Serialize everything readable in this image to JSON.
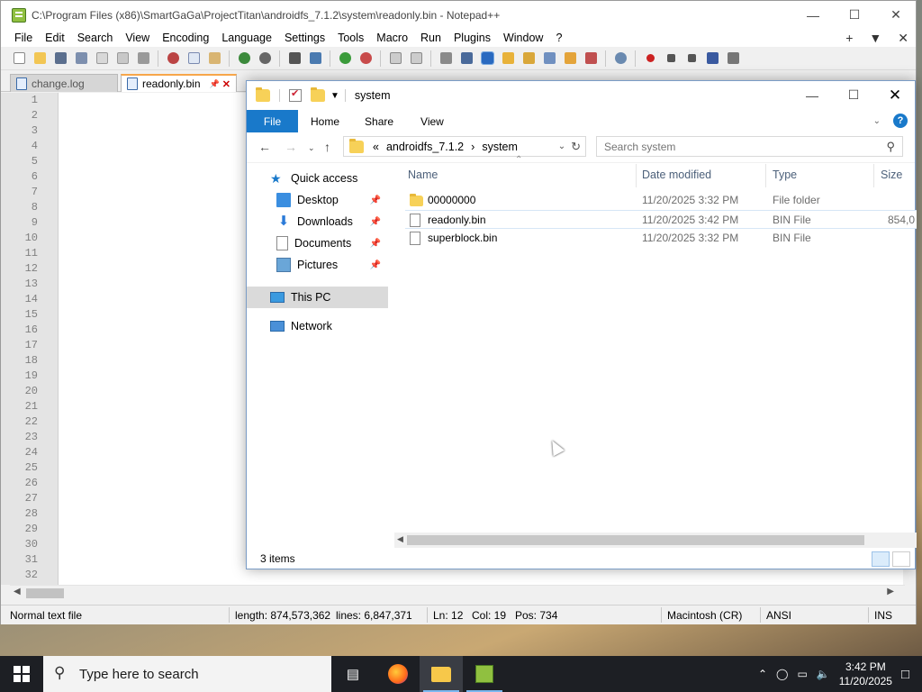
{
  "npp": {
    "title": "C:\\Program Files (x86)\\SmartGaGa\\ProjectTitan\\androidfs_7.1.2\\system\\readonly.bin - Notepad++",
    "menu": [
      "File",
      "Edit",
      "Search",
      "View",
      "Encoding",
      "Language",
      "Settings",
      "Tools",
      "Macro",
      "Run",
      "Plugins",
      "Window",
      "?"
    ],
    "menu_right": [
      "+",
      "▼",
      "✕"
    ],
    "tabs": [
      {
        "label": "change.log"
      },
      {
        "label": "readonly.bin",
        "pin": "📌",
        "close": "✕"
      }
    ],
    "gutter": [
      "1",
      "2",
      "3",
      "4",
      "5",
      "6",
      "7",
      "8",
      "9",
      "10",
      "11",
      "12",
      "13",
      "14",
      "15",
      "16",
      "17",
      "18",
      "19",
      "20",
      "21",
      "22",
      "23",
      "24",
      "25",
      "26",
      "27",
      "28",
      "29",
      "30",
      "31",
      "32"
    ],
    "status": {
      "type": "Normal text file",
      "length": "length: 874,573,362",
      "lines": "lines: 6,847,371",
      "ln": "Ln: 12",
      "col": "Col: 19",
      "pos": "Pos: 734",
      "eol": "Macintosh (CR)",
      "encoding": "ANSI",
      "mode": "INS"
    }
  },
  "explorer": {
    "title": "system",
    "ribbon": {
      "file": "File",
      "home": "Home",
      "share": "Share",
      "view": "View",
      "help": "?"
    },
    "address": {
      "prefix": "«",
      "crumb1": "androidfs_7.1.2",
      "sep": "›",
      "crumb2": "system"
    },
    "search_placeholder": "Search system",
    "nav": {
      "quick_access": "Quick access",
      "desktop": "Desktop",
      "downloads": "Downloads",
      "documents": "Documents",
      "pictures": "Pictures",
      "this_pc": "This PC",
      "network": "Network"
    },
    "columns": {
      "name": "Name",
      "date": "Date modified",
      "type": "Type",
      "size": "Size"
    },
    "files": [
      {
        "name": "00000000",
        "date": "11/20/2025 3:32 PM",
        "type": "File folder",
        "size": "",
        "kind": "folder"
      },
      {
        "name": "readonly.bin",
        "date": "11/20/2025 3:42 PM",
        "type": "BIN File",
        "size": "854,0",
        "kind": "file"
      },
      {
        "name": "superblock.bin",
        "date": "11/20/2025 3:32 PM",
        "type": "BIN File",
        "size": "",
        "kind": "file"
      }
    ],
    "item_count": "3 items"
  },
  "taskbar": {
    "search_text": "Type here to search",
    "time": "3:42 PM",
    "date": "11/20/2025"
  }
}
